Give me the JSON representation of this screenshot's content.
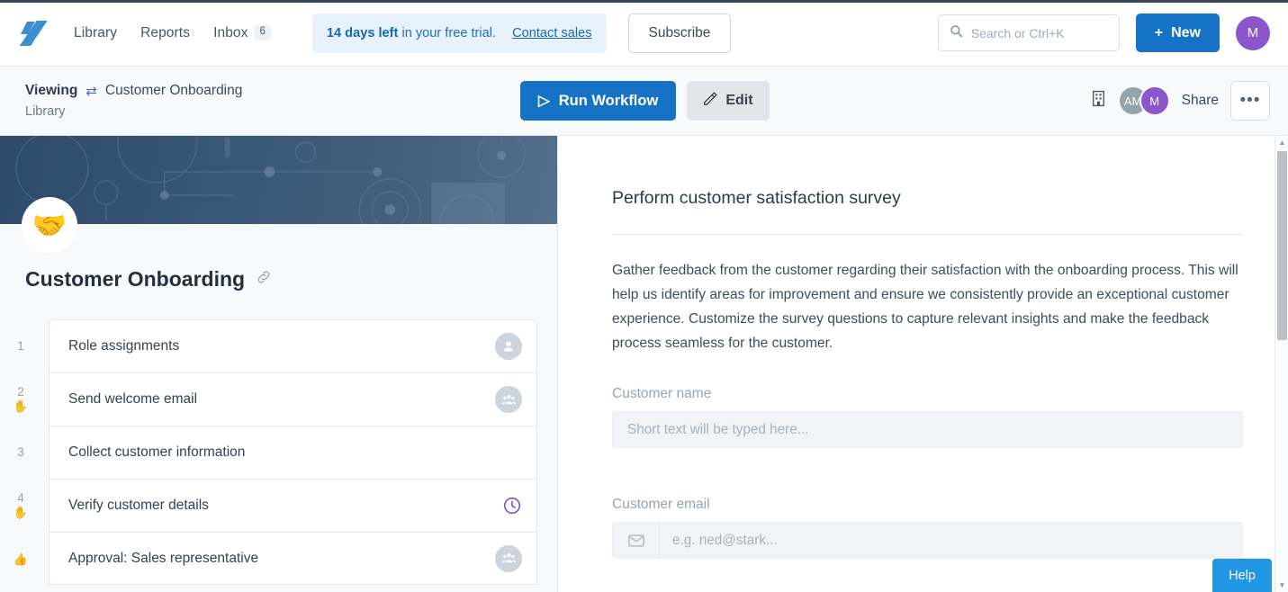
{
  "topnav": {
    "logo_name": "process-street-logo",
    "links": [
      {
        "label": "Library",
        "name": "library"
      },
      {
        "label": "Reports",
        "name": "reports"
      }
    ],
    "inbox": {
      "label": "Inbox",
      "count": "6"
    },
    "trial": {
      "days_bold": "14 days left",
      "rest": " in your free trial.",
      "link": "Contact sales"
    },
    "subscribe_label": "Subscribe",
    "search": {
      "placeholder": "Search or Ctrl+K",
      "icon": "search-icon"
    },
    "new_button": {
      "label": "New",
      "plus": "+"
    },
    "user_avatar": {
      "initials": "M",
      "color": "#8b55ce"
    }
  },
  "subbar": {
    "viewing_label": "Viewing",
    "swap_icon": "⇄",
    "workflow_name": "Customer Onboarding",
    "location": "Library",
    "run_label": "Run Workflow",
    "run_icon": "▷",
    "edit_label": "Edit",
    "edit_icon": "✎",
    "org_icon": "building-icon",
    "avatars": [
      {
        "initials": "AM",
        "color": "#94a3ae"
      },
      {
        "initials": "M",
        "color": "#8b55ce"
      }
    ],
    "share_label": "Share",
    "more_label": "•••"
  },
  "left_panel": {
    "emoji": "🤝",
    "title": "Customer Onboarding",
    "link_icon": "⧉",
    "steps": [
      {
        "num": "1",
        "name": "Role assignments",
        "badge": "person-icon",
        "stop": ""
      },
      {
        "num": "2",
        "name": "Send welcome email",
        "badge": "group-icon",
        "stop": "✋"
      },
      {
        "num": "3",
        "name": "Collect customer information",
        "badge": "",
        "stop": ""
      },
      {
        "num": "4",
        "name": "Verify customer details",
        "badge": "clock-icon",
        "stop": "✋"
      },
      {
        "num": "",
        "name": "Approval: Sales representative",
        "badge": "group-icon",
        "stop": "👍"
      }
    ]
  },
  "right_panel": {
    "task_title": "Perform customer satisfaction survey",
    "description": "Gather feedback from the customer regarding their satisfaction with the onboarding process. This will help us identify areas for improvement and ensure we consistently provide an exceptional customer experience. Customize the survey questions to capture relevant insights and make the feedback process seamless for the customer.",
    "fields": [
      {
        "label": "Customer name",
        "placeholder": "Short text will be typed here...",
        "icon": ""
      },
      {
        "label": "Customer email",
        "placeholder": "e.g. ned@stark...",
        "icon": "envelope-icon"
      }
    ]
  },
  "help": {
    "label": "Help"
  },
  "colors": {
    "accent_blue": "#1572c4",
    "trial_bg": "#e8f2fd",
    "purple": "#6b46d1",
    "help_blue": "#2196e3"
  }
}
